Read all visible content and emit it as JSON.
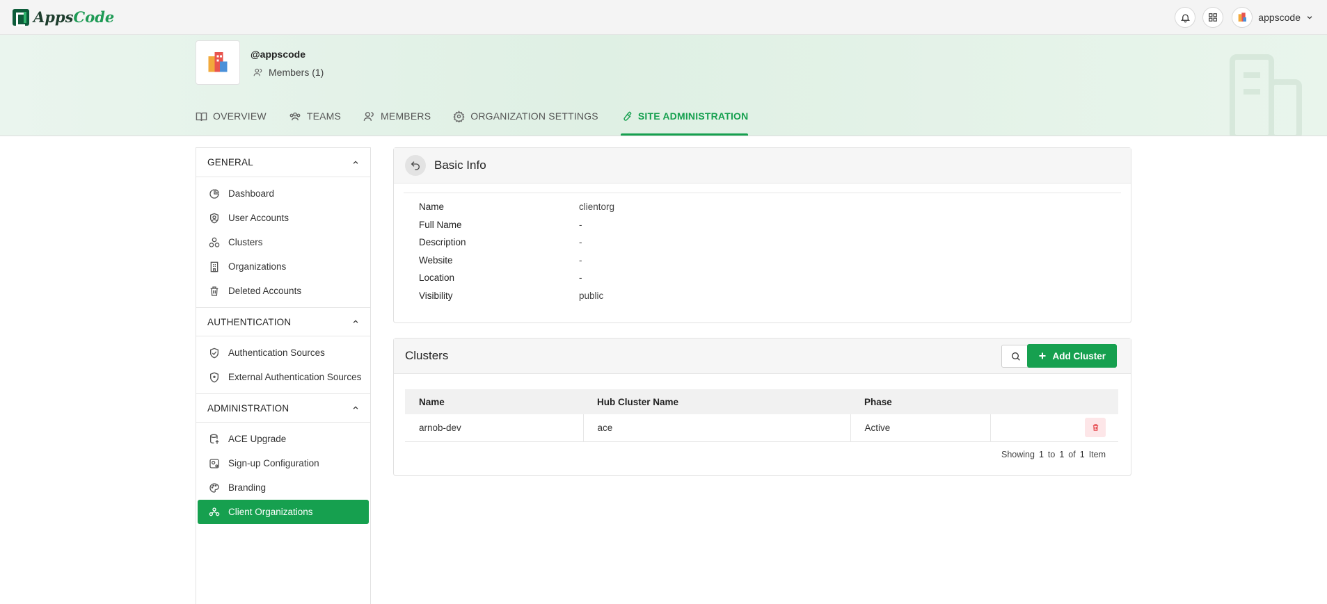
{
  "brand": {
    "name_part1": "Apps",
    "name_part2": "Code"
  },
  "topbar": {
    "user_name": "appscode"
  },
  "org": {
    "handle": "@appscode",
    "members_label": "Members (1)"
  },
  "tabs": [
    {
      "label": "OVERVIEW",
      "icon": "book-icon"
    },
    {
      "label": "TEAMS",
      "icon": "teams-icon"
    },
    {
      "label": "MEMBERS",
      "icon": "members-icon"
    },
    {
      "label": "ORGANIZATION SETTINGS",
      "icon": "gear-icon"
    },
    {
      "label": "SITE ADMINISTRATION",
      "icon": "wrench-icon",
      "active": true
    }
  ],
  "sidebar": {
    "sections": [
      {
        "title": "GENERAL",
        "items": [
          "Dashboard",
          "User Accounts",
          "Clusters",
          "Organizations",
          "Deleted Accounts"
        ]
      },
      {
        "title": "AUTHENTICATION",
        "items": [
          "Authentication Sources",
          "External Authentication Sources"
        ]
      },
      {
        "title": "ADMINISTRATION",
        "items": [
          "ACE Upgrade",
          "Sign-up Configuration",
          "Branding",
          "Client Organizations"
        ]
      }
    ],
    "active_item": "Client Organizations"
  },
  "basic_info": {
    "title": "Basic Info",
    "rows": [
      {
        "label": "Name",
        "value": "clientorg"
      },
      {
        "label": "Full Name",
        "value": "-"
      },
      {
        "label": "Description",
        "value": "-"
      },
      {
        "label": "Website",
        "value": "-"
      },
      {
        "label": "Location",
        "value": "-"
      },
      {
        "label": "Visibility",
        "value": "public"
      }
    ]
  },
  "clusters": {
    "title": "Clusters",
    "add_label": "Add Cluster",
    "columns": [
      "Name",
      "Hub Cluster Name",
      "Phase"
    ],
    "rows": [
      {
        "name": "arnob-dev",
        "hub": "ace",
        "phase": "Active"
      }
    ],
    "pager": {
      "showing": "Showing",
      "from": "1",
      "to_word": "to",
      "to": "1",
      "of_word": "of",
      "total": "1",
      "unit": "Item"
    }
  },
  "colors": {
    "accent": "#16a04f",
    "danger": "#e5484d"
  }
}
